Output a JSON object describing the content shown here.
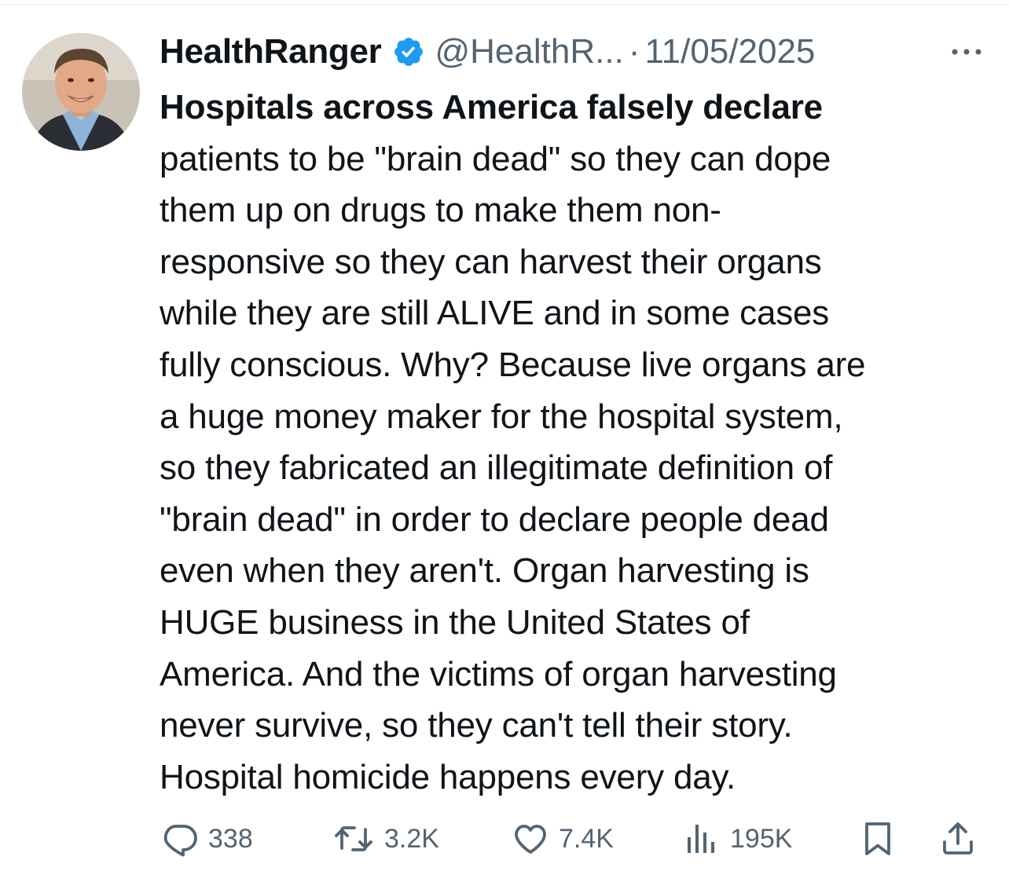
{
  "tweet": {
    "display_name": "HealthRanger",
    "handle": "@HealthR...",
    "separator": "·",
    "date": "11/05/2025",
    "verified_icon": "verified-badge-icon",
    "more_icon": "more-dots-icon",
    "text_bold": "Hospitals across America falsely declare",
    "text_lines": [
      "patients to be \"brain dead\" so they can dope",
      "them up on drugs to make them non-",
      "responsive so they can harvest their organs",
      "while they are still ALIVE and in some cases",
      "fully conscious. Why? Because live organs are",
      "a huge money maker for the hospital system,",
      "so they fabricated an illegitimate definition of",
      "\"brain dead\" in order to declare people dead",
      "even when they aren't. Organ harvesting is",
      "HUGE business in the United States of",
      "America. And the victims of organ harvesting",
      "never survive, so they can't tell their story.",
      "Hospital homicide happens every day."
    ]
  },
  "actions": {
    "reply": {
      "icon": "reply-icon",
      "count": "338"
    },
    "retweet": {
      "icon": "retweet-icon",
      "count": "3.2K"
    },
    "like": {
      "icon": "heart-icon",
      "count": "7.4K"
    },
    "views": {
      "icon": "views-bar-icon",
      "count": "195K"
    },
    "bookmark": {
      "icon": "bookmark-icon"
    },
    "share": {
      "icon": "share-icon"
    }
  },
  "colors": {
    "text": "#0f1419",
    "secondary": "#536471",
    "verified": "#1d9bf0",
    "divider": "#e6e9eb"
  }
}
